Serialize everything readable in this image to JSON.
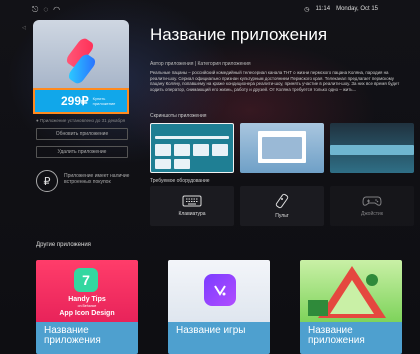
{
  "status": {
    "icons": [
      "cast-icon",
      "settings-icon",
      "wifi-icon"
    ],
    "time": "11:14",
    "date": "Monday, Oct 15"
  },
  "app": {
    "title": "Название приложения",
    "author_category": "Автор приложения | Категория приложения",
    "description": "Реальные пацаны – российский комедийный телесериал канала ТНТ о жизни пермского пацана Коляна, пародия на реалити-шоу. Сериал официально признан культурным достоянием Пермского края. Телеканал предлагает пермскому пацану Коляну, попавшему на краже кондиционера реалити-шоу, принять участие в реалити-шоу. За них все время будет ходить оператор, снимающий его жизнь, работу и друзей. От Коляна требуется только одно – жить...",
    "price": "299₽",
    "price_sub": "Купить приложение",
    "installed_text": "● Приложение установлено до 31 декабря",
    "update_button": "Обновить приложение",
    "delete_button": "Удалить приложение",
    "inapp_text": "Приложение имеет наличие встроенных покупок",
    "rub_symbol": "₽"
  },
  "screenshots_title": "Скриншоты приложения",
  "hardware_title": "Требуемое оборудование",
  "hardware": [
    {
      "label": "Клавиатура",
      "icon": "keyboard-icon"
    },
    {
      "label": "Пульт",
      "icon": "remote-icon"
    },
    {
      "label": "Джойстик",
      "icon": "gamepad-icon"
    }
  ],
  "others_title": "Другие приложения",
  "others": [
    {
      "label": "Название приложения",
      "art_title": "Handy Tips",
      "art_sub": "on Behance",
      "art_footer": "App Icon Design",
      "art_number": "7"
    },
    {
      "label": "Название игры"
    },
    {
      "label": "Название приложения"
    }
  ],
  "colors": {
    "accent": "#11a7ea",
    "focus": "#ff8a1f",
    "card_footer": "#4ea0cf"
  }
}
